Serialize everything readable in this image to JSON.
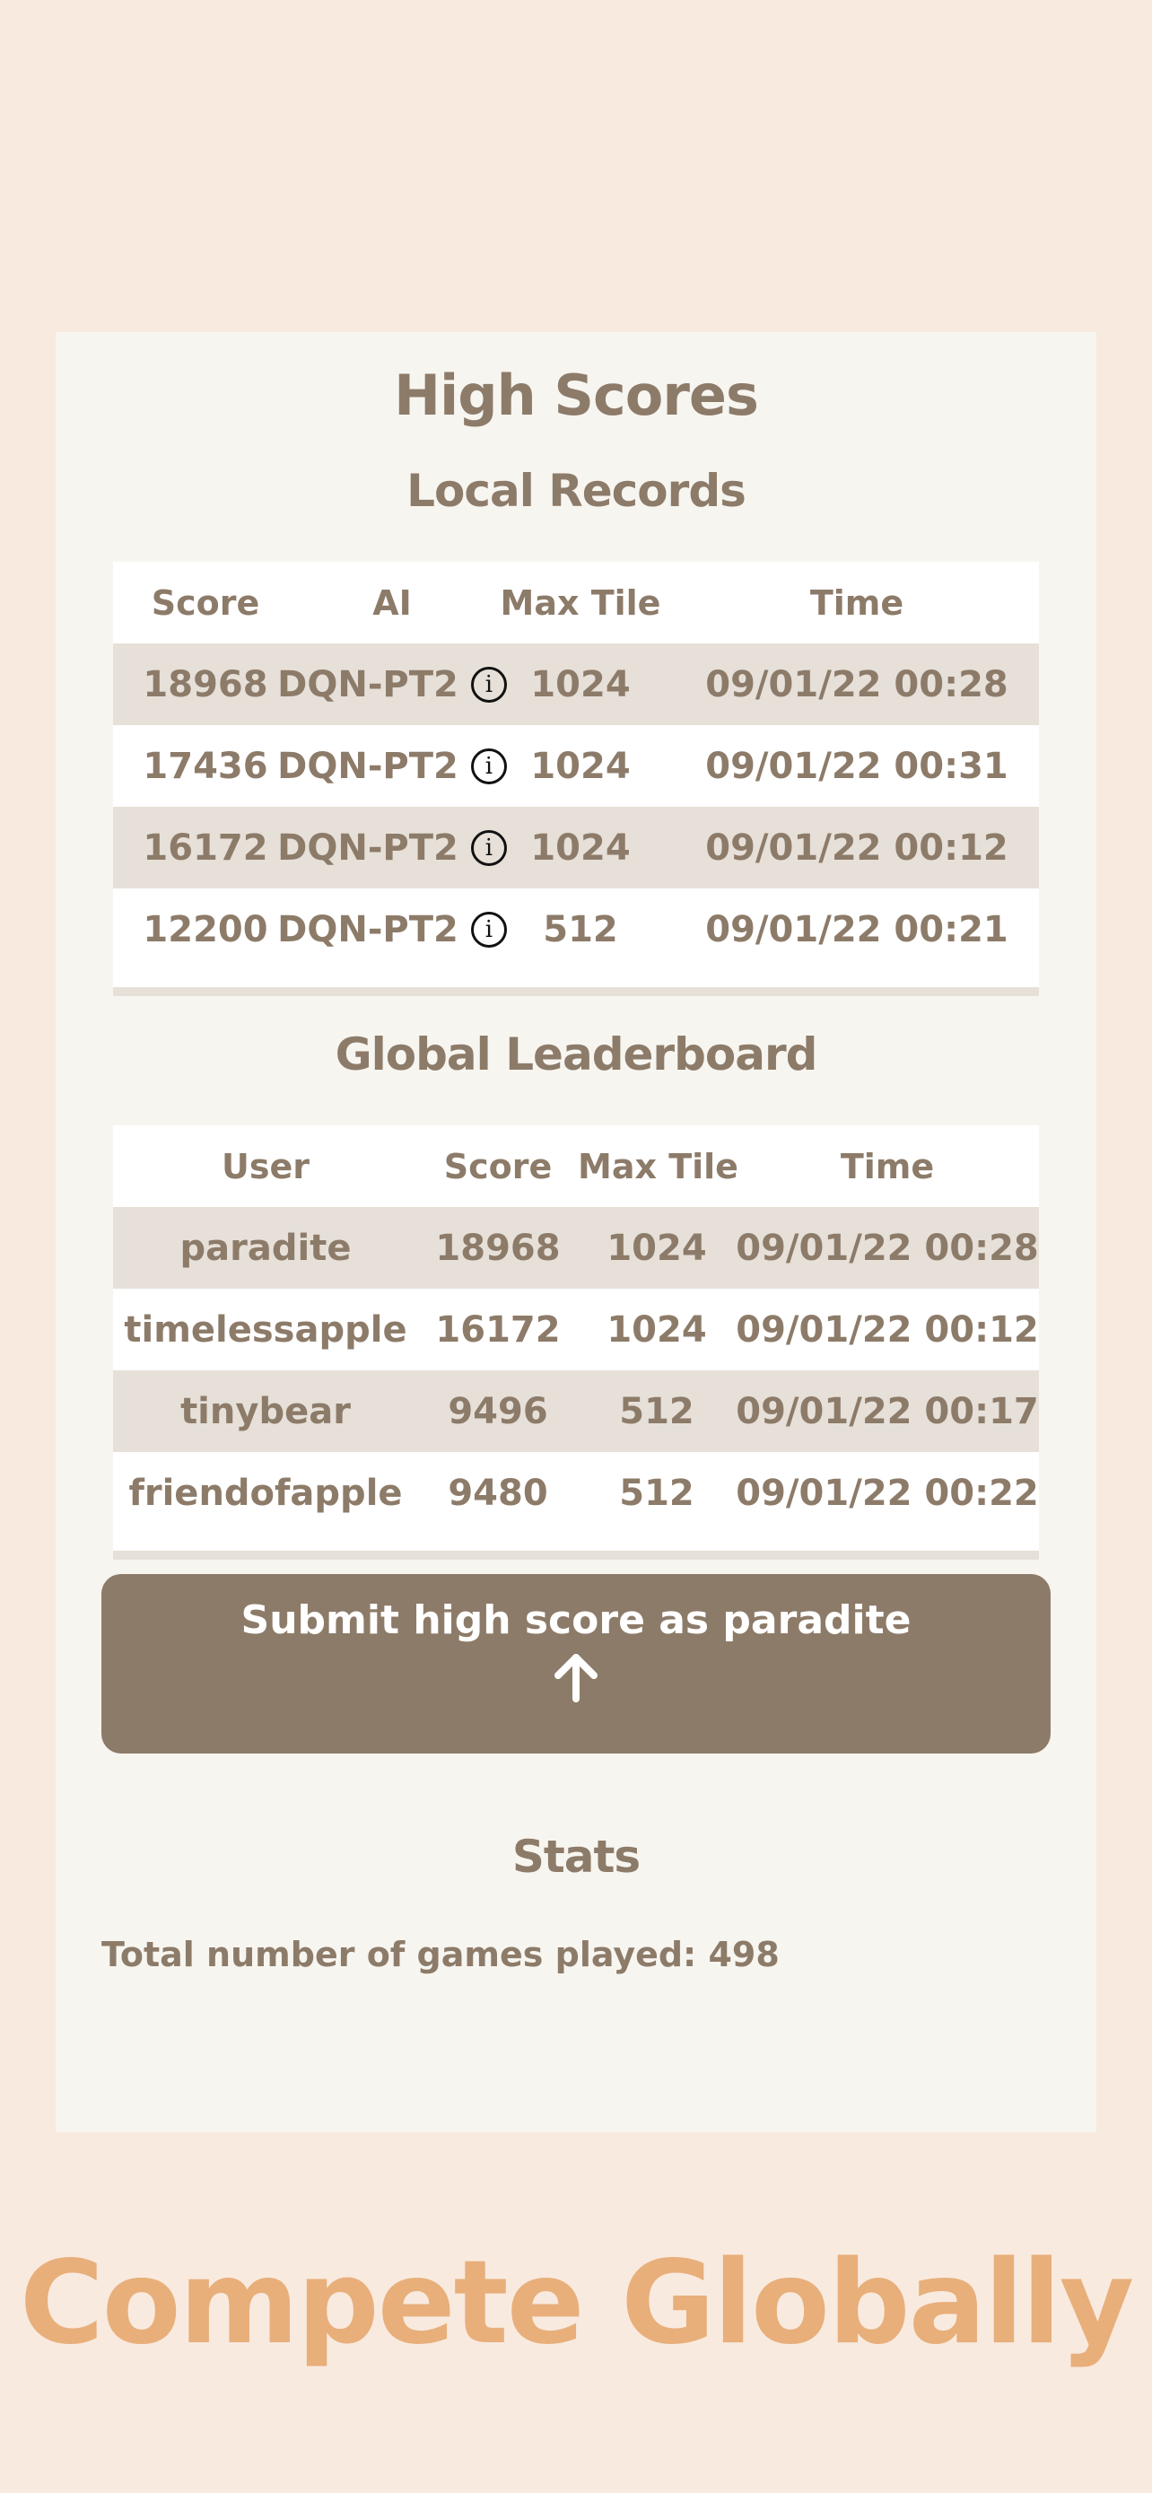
{
  "high_scores": {
    "title": "High Scores"
  },
  "local_records": {
    "title": "Local Records",
    "headers": {
      "score": "Score",
      "ai": "AI",
      "max_tile": "Max Tile",
      "time": "Time"
    },
    "rows": [
      {
        "score": "18968",
        "ai": "DQN-PT2",
        "max_tile": "1024",
        "time": "09/01/22 00:28"
      },
      {
        "score": "17436",
        "ai": "DQN-PT2",
        "max_tile": "1024",
        "time": "09/01/22 00:31"
      },
      {
        "score": "16172",
        "ai": "DQN-PT2",
        "max_tile": "1024",
        "time": "09/01/22 00:12"
      },
      {
        "score": "12200",
        "ai": "DQN-PT2",
        "max_tile": "512",
        "time": "09/01/22 00:21"
      }
    ],
    "info_icon": "info-icon"
  },
  "global_leaderboard": {
    "title": "Global Leaderboard",
    "headers": {
      "user": "User",
      "score": "Score",
      "max_tile": "Max Tile",
      "time": "Time"
    },
    "rows": [
      {
        "user": "paradite",
        "score": "18968",
        "max_tile": "1024",
        "time": "09/01/22 00:28"
      },
      {
        "user": "timelessapple",
        "score": "16172",
        "max_tile": "1024",
        "time": "09/01/22 00:12"
      },
      {
        "user": "tinybear",
        "score": "9496",
        "max_tile": "512",
        "time": "09/01/22 00:17"
      },
      {
        "user": "friendofapple",
        "score": "9480",
        "max_tile": "512",
        "time": "09/01/22 00:22"
      }
    ]
  },
  "submit_button": {
    "label": "Submit high score as paradite",
    "icon": "arrow-up-icon"
  },
  "stats": {
    "title": "Stats",
    "total_games_text": "Total number of games played: 498"
  },
  "hero": {
    "text": "Compete Globally"
  },
  "colors": {
    "page_background": "#f9eadf",
    "panel_background": "#f7f5f0",
    "text_brown": "#8d7b69",
    "row_shade": "#e6e0d9",
    "accent_orange": "#e8af7b"
  }
}
